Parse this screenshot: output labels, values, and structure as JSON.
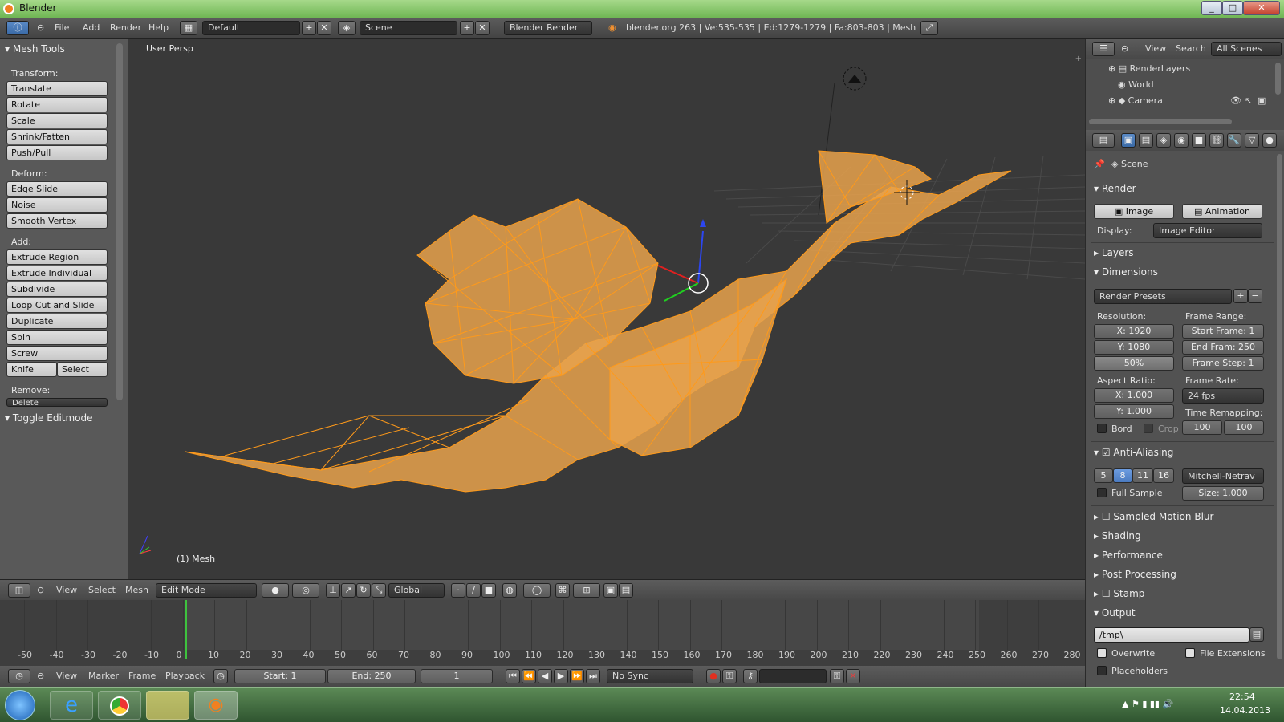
{
  "window": {
    "title": "Blender"
  },
  "infobar": {
    "menus": [
      "File",
      "Add",
      "Render",
      "Help"
    ],
    "layout": "Default",
    "scene": "Scene",
    "engine": "Blender Render",
    "stats": "blender.org 263 | Ve:535-535 | Ed:1279-1279 | Fa:803-803 | Mesh"
  },
  "toolshelf": {
    "title": "Mesh Tools",
    "sections": [
      {
        "label": "Transform:",
        "buttons": [
          "Translate",
          "Rotate",
          "Scale",
          "Shrink/Fatten",
          "Push/Pull"
        ]
      },
      {
        "label": "Deform:",
        "buttons": [
          "Edge Slide",
          "Noise",
          "Smooth Vertex"
        ]
      },
      {
        "label": "Add:",
        "buttons": [
          "Extrude Region",
          "Extrude Individual",
          "Subdivide",
          "Loop Cut and Slide",
          "Duplicate",
          "Spin",
          "Screw"
        ]
      }
    ],
    "knife": "Knife",
    "select": "Select",
    "remove_label": "Remove:",
    "delete": "Delete",
    "toggle": "Toggle Editmode"
  },
  "viewport": {
    "view_name": "User Persp",
    "object_info": "(1) Mesh",
    "mesh_color": "#e8a24c",
    "wire_color": "#ff9a1a"
  },
  "vpheader": {
    "menus": [
      "View",
      "Select",
      "Mesh"
    ],
    "mode": "Edit Mode",
    "orientation": "Global"
  },
  "timeline": {
    "ticks": [
      "-50",
      "-40",
      "-30",
      "-20",
      "-10",
      "0",
      "10",
      "20",
      "30",
      "40",
      "50",
      "60",
      "70",
      "80",
      "90",
      "100",
      "110",
      "120",
      "130",
      "140",
      "150",
      "160",
      "170",
      "180",
      "190",
      "200",
      "210",
      "220",
      "230",
      "240",
      "250",
      "260",
      "270",
      "280"
    ],
    "menus": [
      "View",
      "Marker",
      "Frame",
      "Playback"
    ],
    "start": "Start: 1",
    "end": "End: 250",
    "current": "1",
    "sync": "No Sync"
  },
  "outliner": {
    "menus": [
      "View",
      "Search"
    ],
    "filter": "All Scenes",
    "items": [
      "RenderLayers",
      "World",
      "Camera"
    ]
  },
  "properties": {
    "context": "Scene",
    "render_header": "Render",
    "image_btn": "Image",
    "animation_btn": "Animation",
    "display_label": "Display:",
    "display_value": "Image Editor",
    "layers": "Layers",
    "dimensions": "Dimensions",
    "presets": "Render Presets",
    "resolution_label": "Resolution:",
    "res_x": "X: 1920",
    "res_y": "Y: 1080",
    "res_pct": "50%",
    "frame_range_label": "Frame Range:",
    "start_frame": "Start Frame: 1",
    "end_frame": "End Fram: 250",
    "frame_step": "Frame Step: 1",
    "aspect_label": "Aspect Ratio:",
    "aspect_x": "X: 1.000",
    "aspect_y": "Y: 1.000",
    "frame_rate_label": "Frame Rate:",
    "fps": "24 fps",
    "time_remap_label": "Time Remapping:",
    "remap_old": "100",
    "remap_new": "100",
    "bord": "Bord",
    "crop": "Crop",
    "aa": "Anti-Aliasing",
    "aa_samples": [
      "5",
      "8",
      "11",
      "16"
    ],
    "aa_filter": "Mitchell-Netrav",
    "full_sample": "Full Sample",
    "size": "Size: 1.000",
    "motion_blur": "Sampled Motion Blur",
    "shading": "Shading",
    "performance": "Performance",
    "post": "Post Processing",
    "stamp": "Stamp",
    "output": "Output",
    "path": "/tmp\\",
    "overwrite": "Overwrite",
    "file_ext": "File Extensions",
    "placeholders": "Placeholders"
  },
  "taskbar": {
    "time": "22:54",
    "date": "14.04.2013"
  }
}
